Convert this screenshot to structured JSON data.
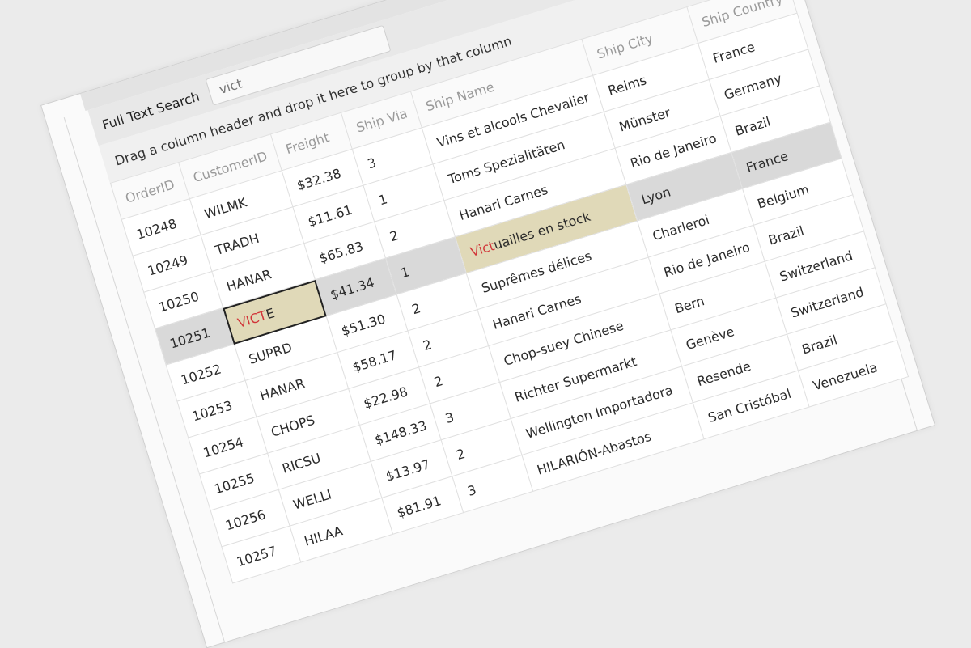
{
  "search": {
    "label": "Full Text Search",
    "value": "vict"
  },
  "group_panel": {
    "text": "Drag a column header and drop it here to group by that column"
  },
  "grid": {
    "columns": [
      "OrderID",
      "CustomerID",
      "Freight",
      "Ship Via",
      "Ship Name",
      "Ship City",
      "Ship Country"
    ],
    "rows": [
      {
        "order": "10248",
        "customer": "WILMK",
        "freight": "$32.38",
        "via": "3",
        "ship_name": "Vins et alcools Chevalier",
        "city": "Reims",
        "country": "France"
      },
      {
        "order": "10249",
        "customer": "TRADH",
        "freight": "$11.61",
        "via": "1",
        "ship_name": "Toms Spezialitäten",
        "city": "Münster",
        "country": "Germany"
      },
      {
        "order": "10250",
        "customer": "HANAR",
        "freight": "$65.83",
        "via": "2",
        "ship_name": "Hanari Carnes",
        "city": "Rio de Janeiro",
        "country": "Brazil"
      },
      {
        "order": "10251",
        "customer_match": "VICT",
        "customer_rest": "E",
        "freight": "$41.34",
        "via": "1",
        "ship_name_match": "Vict",
        "ship_name_rest": "uailles en stock",
        "city": "Lyon",
        "country": "France"
      },
      {
        "order": "10252",
        "customer": "SUPRD",
        "freight": "$51.30",
        "via": "2",
        "ship_name": "Suprêmes délices",
        "city": "Charleroi",
        "country": "Belgium"
      },
      {
        "order": "10253",
        "customer": "HANAR",
        "freight": "$58.17",
        "via": "2",
        "ship_name": "Hanari Carnes",
        "city": "Rio de Janeiro",
        "country": "Brazil"
      },
      {
        "order": "10254",
        "customer": "CHOPS",
        "freight": "$22.98",
        "via": "2",
        "ship_name": "Chop-suey Chinese",
        "city": "Bern",
        "country": "Switzerland"
      },
      {
        "order": "10255",
        "customer": "RICSU",
        "freight": "$148.33",
        "via": "3",
        "ship_name": "Richter Supermarkt",
        "city": "Genève",
        "country": "Switzerland"
      },
      {
        "order": "10256",
        "customer": "WELLI",
        "freight": "$13.97",
        "via": "2",
        "ship_name": "Wellington Importadora",
        "city": "Resende",
        "country": "Brazil"
      },
      {
        "order": "10257",
        "customer": "HILAA",
        "freight": "$81.91",
        "via": "3",
        "ship_name": "HILARIÓN-Abastos",
        "city": "San Cristóbal",
        "country": "Venezuela"
      }
    ]
  },
  "colors": {
    "match_text": "#d13438",
    "match_bg": "#e0d9b8",
    "highlight_row": "#d9d9d9"
  }
}
